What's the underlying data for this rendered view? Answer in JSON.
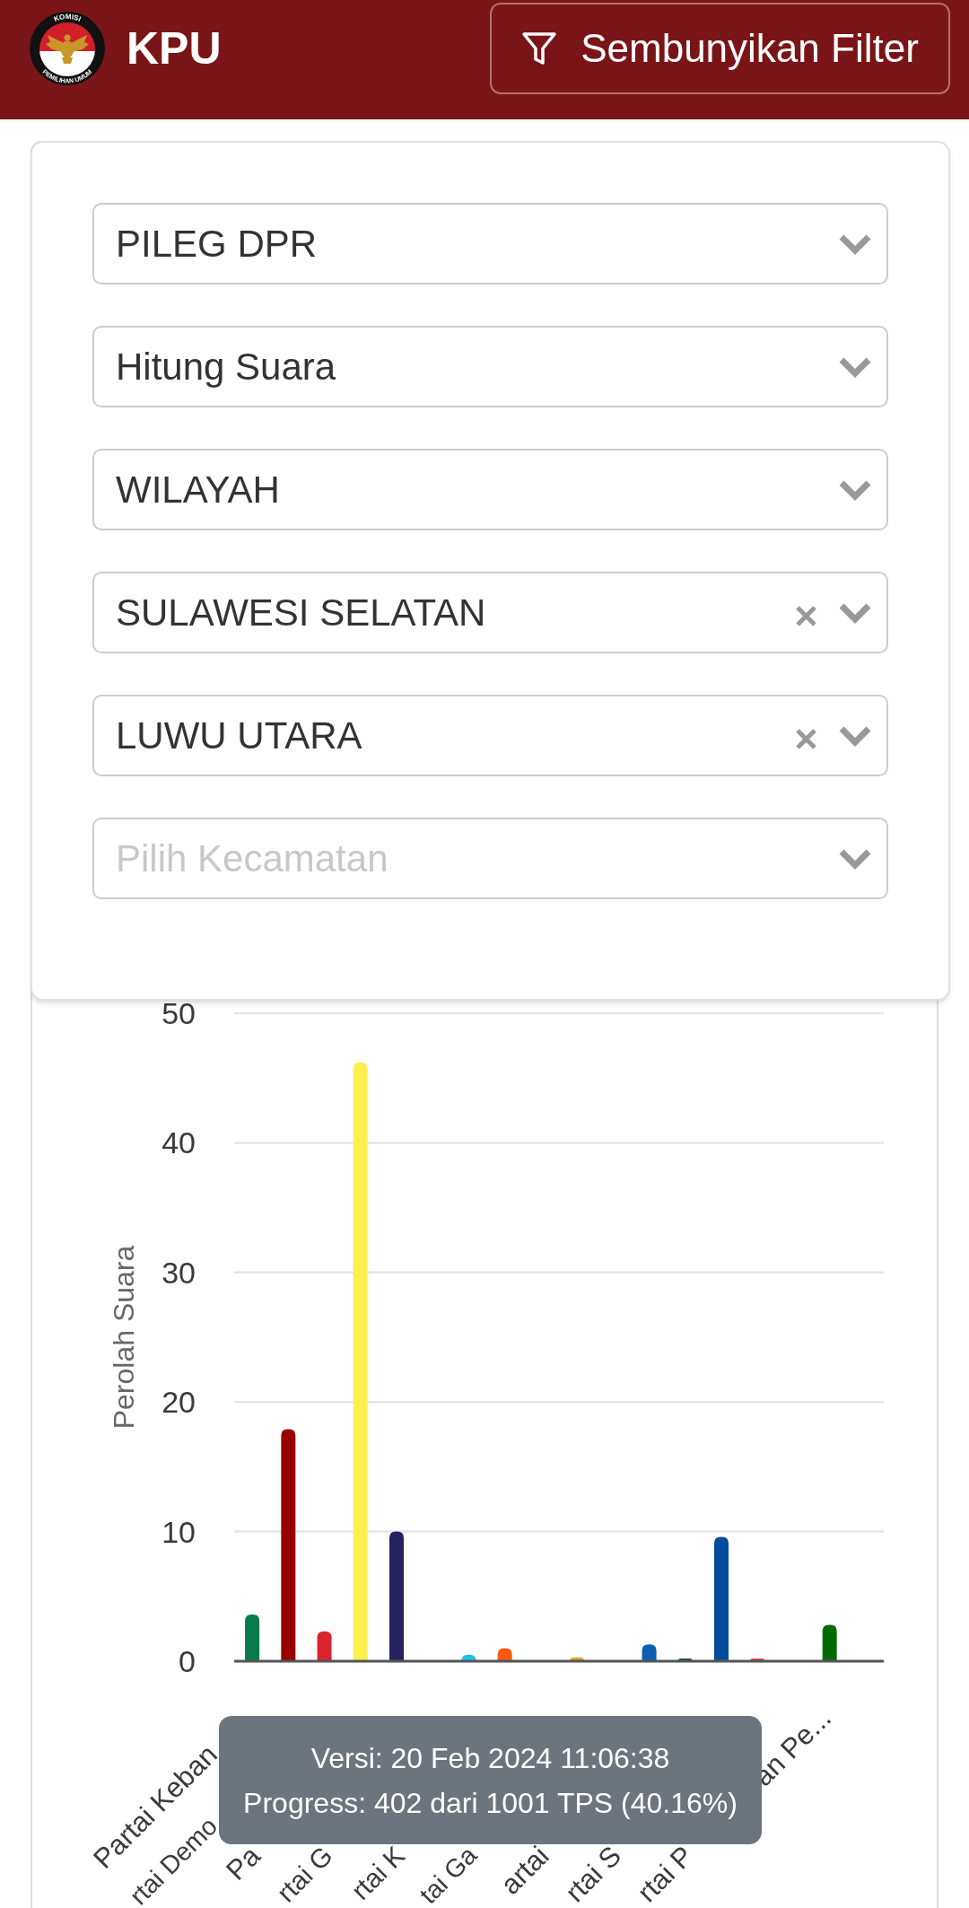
{
  "header": {
    "title": "KPU",
    "emblem_texts": [
      "KOMISI",
      "PEMILIHAN UMUM"
    ],
    "filter_button": {
      "label": "Sembunyikan Filter"
    }
  },
  "filter_panel": {
    "selects": [
      {
        "value": "PILEG DPR",
        "clearable": false
      },
      {
        "value": "Hitung Suara",
        "clearable": false
      },
      {
        "value": "WILAYAH",
        "clearable": false
      },
      {
        "value": "SULAWESI SELATAN",
        "clearable": true
      },
      {
        "value": "LUWU UTARA",
        "clearable": true
      },
      {
        "placeholder": "Pilih Kecamatan",
        "clearable": false
      }
    ]
  },
  "vote_chart": {
    "chart_data": {
      "type": "bar",
      "grid": true,
      "ylabel": "Perolah Suara",
      "ylim": [
        0,
        50
      ],
      "yticks": [
        0,
        10,
        20,
        30,
        40,
        50
      ],
      "series": [
        {
          "values": [
            3.6,
            17.9,
            2.3,
            46.2,
            10,
            0,
            0.5,
            1,
            0,
            0.3,
            0,
            1.3,
            0.2,
            9.6,
            0.2,
            0,
            2.8,
            0
          ],
          "colors": [
            "#087a4c",
            "#990000",
            "#d92530",
            "#fff04f",
            "#25235f",
            null,
            "#1ec0f0",
            "#fc5a12",
            null,
            "#e0a238",
            null,
            "#0a5fb0",
            "#15503a",
            "#054b9c",
            "#e0404e",
            null,
            "#006a00",
            null
          ]
        }
      ]
    },
    "x_tick_labels": [
      {
        "start": "Partai Keban"
      },
      {
        "start": "rtai Demo"
      },
      {
        "start": "Pa"
      },
      {
        "start": "rtai G"
      },
      {
        "start": "rtai K"
      },
      {
        "start": "tai Ga"
      },
      {
        "start": "artai"
      },
      {
        "start": "rtai S"
      },
      {
        "start": "rtai P",
        "end": "an Pe..."
      }
    ]
  },
  "tooltip": {
    "lines": [
      "Versi: 20 Feb 2024 11:06:38",
      "Progress: 402 dari 1001 TPS (40.16%)"
    ]
  }
}
